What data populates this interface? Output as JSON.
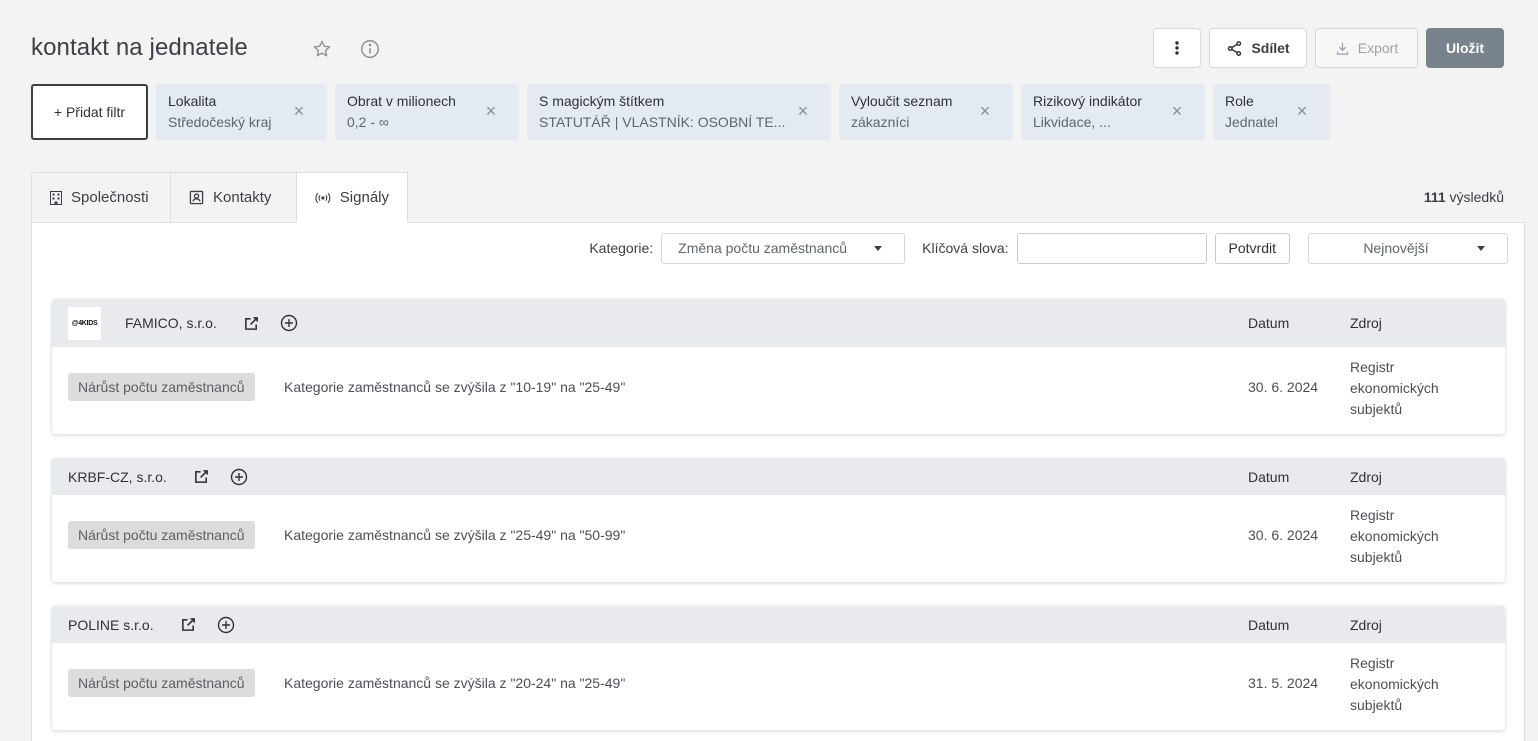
{
  "header": {
    "title": "kontakt na jednatele",
    "share_label": "Sdílet",
    "export_label": "Export",
    "save_label": "Uložit"
  },
  "filters": {
    "add_label": "+ Přidat filtr",
    "chips": [
      {
        "label": "Lokalita",
        "value": "Středočeský kraj"
      },
      {
        "label": "Obrat v milionech",
        "value": "0,2 - ∞"
      },
      {
        "label": "S magickým štítkem",
        "value": "STATUTÁŘ | VLASTNÍK: OSOBNÍ TE..."
      },
      {
        "label": "Vyloučit seznam",
        "value": "zákazníci"
      },
      {
        "label": "Rizikový indikátor",
        "value": "Likvidace, ..."
      },
      {
        "label": "Role",
        "value": "Jednatel"
      }
    ]
  },
  "tabs": [
    {
      "label": "Společnosti",
      "icon": "building-icon"
    },
    {
      "label": "Kontakty",
      "icon": "contact-card-icon"
    },
    {
      "label": "Signály",
      "icon": "signal-icon"
    }
  ],
  "results": {
    "count": "111",
    "label": "výsledků"
  },
  "toolbar": {
    "category_label": "Kategorie:",
    "category_value": "Změna počtu zaměstnanců",
    "keywords_label": "Klíčová slova:",
    "keywords_value": "",
    "confirm_label": "Potvrdit",
    "sort_value": "Nejnovější"
  },
  "columns": {
    "date": "Datum",
    "source": "Zdroj"
  },
  "signals": [
    {
      "company": "FAMICO, s.r.o.",
      "logo_text": "@4KIDS",
      "tag": "Nárůst počtu zaměstnanců",
      "description": "Kategorie zaměstnanců se zvýšila z \"10-19\" na \"25-49\"",
      "date": "30. 6. 2024",
      "source_lines": [
        "Registr",
        "ekonomických",
        "subjektů"
      ]
    },
    {
      "company": "KRBF-CZ, s.r.o.",
      "tag": "Nárůst počtu zaměstnanců",
      "description": "Kategorie zaměstnanců se zvýšila z \"25-49\" na \"50-99\"",
      "date": "30. 6. 2024",
      "source_lines": [
        "Registr",
        "ekonomických",
        "subjektů"
      ]
    },
    {
      "company": "POLINE s.r.o.",
      "tag": "Nárůst počtu zaměstnanců",
      "description": "Kategorie zaměstnanců se zvýšila z \"20-24\" na \"25-49\"",
      "date": "31. 5. 2024",
      "source_lines": [
        "Registr",
        "ekonomických",
        "subjektů"
      ]
    }
  ]
}
